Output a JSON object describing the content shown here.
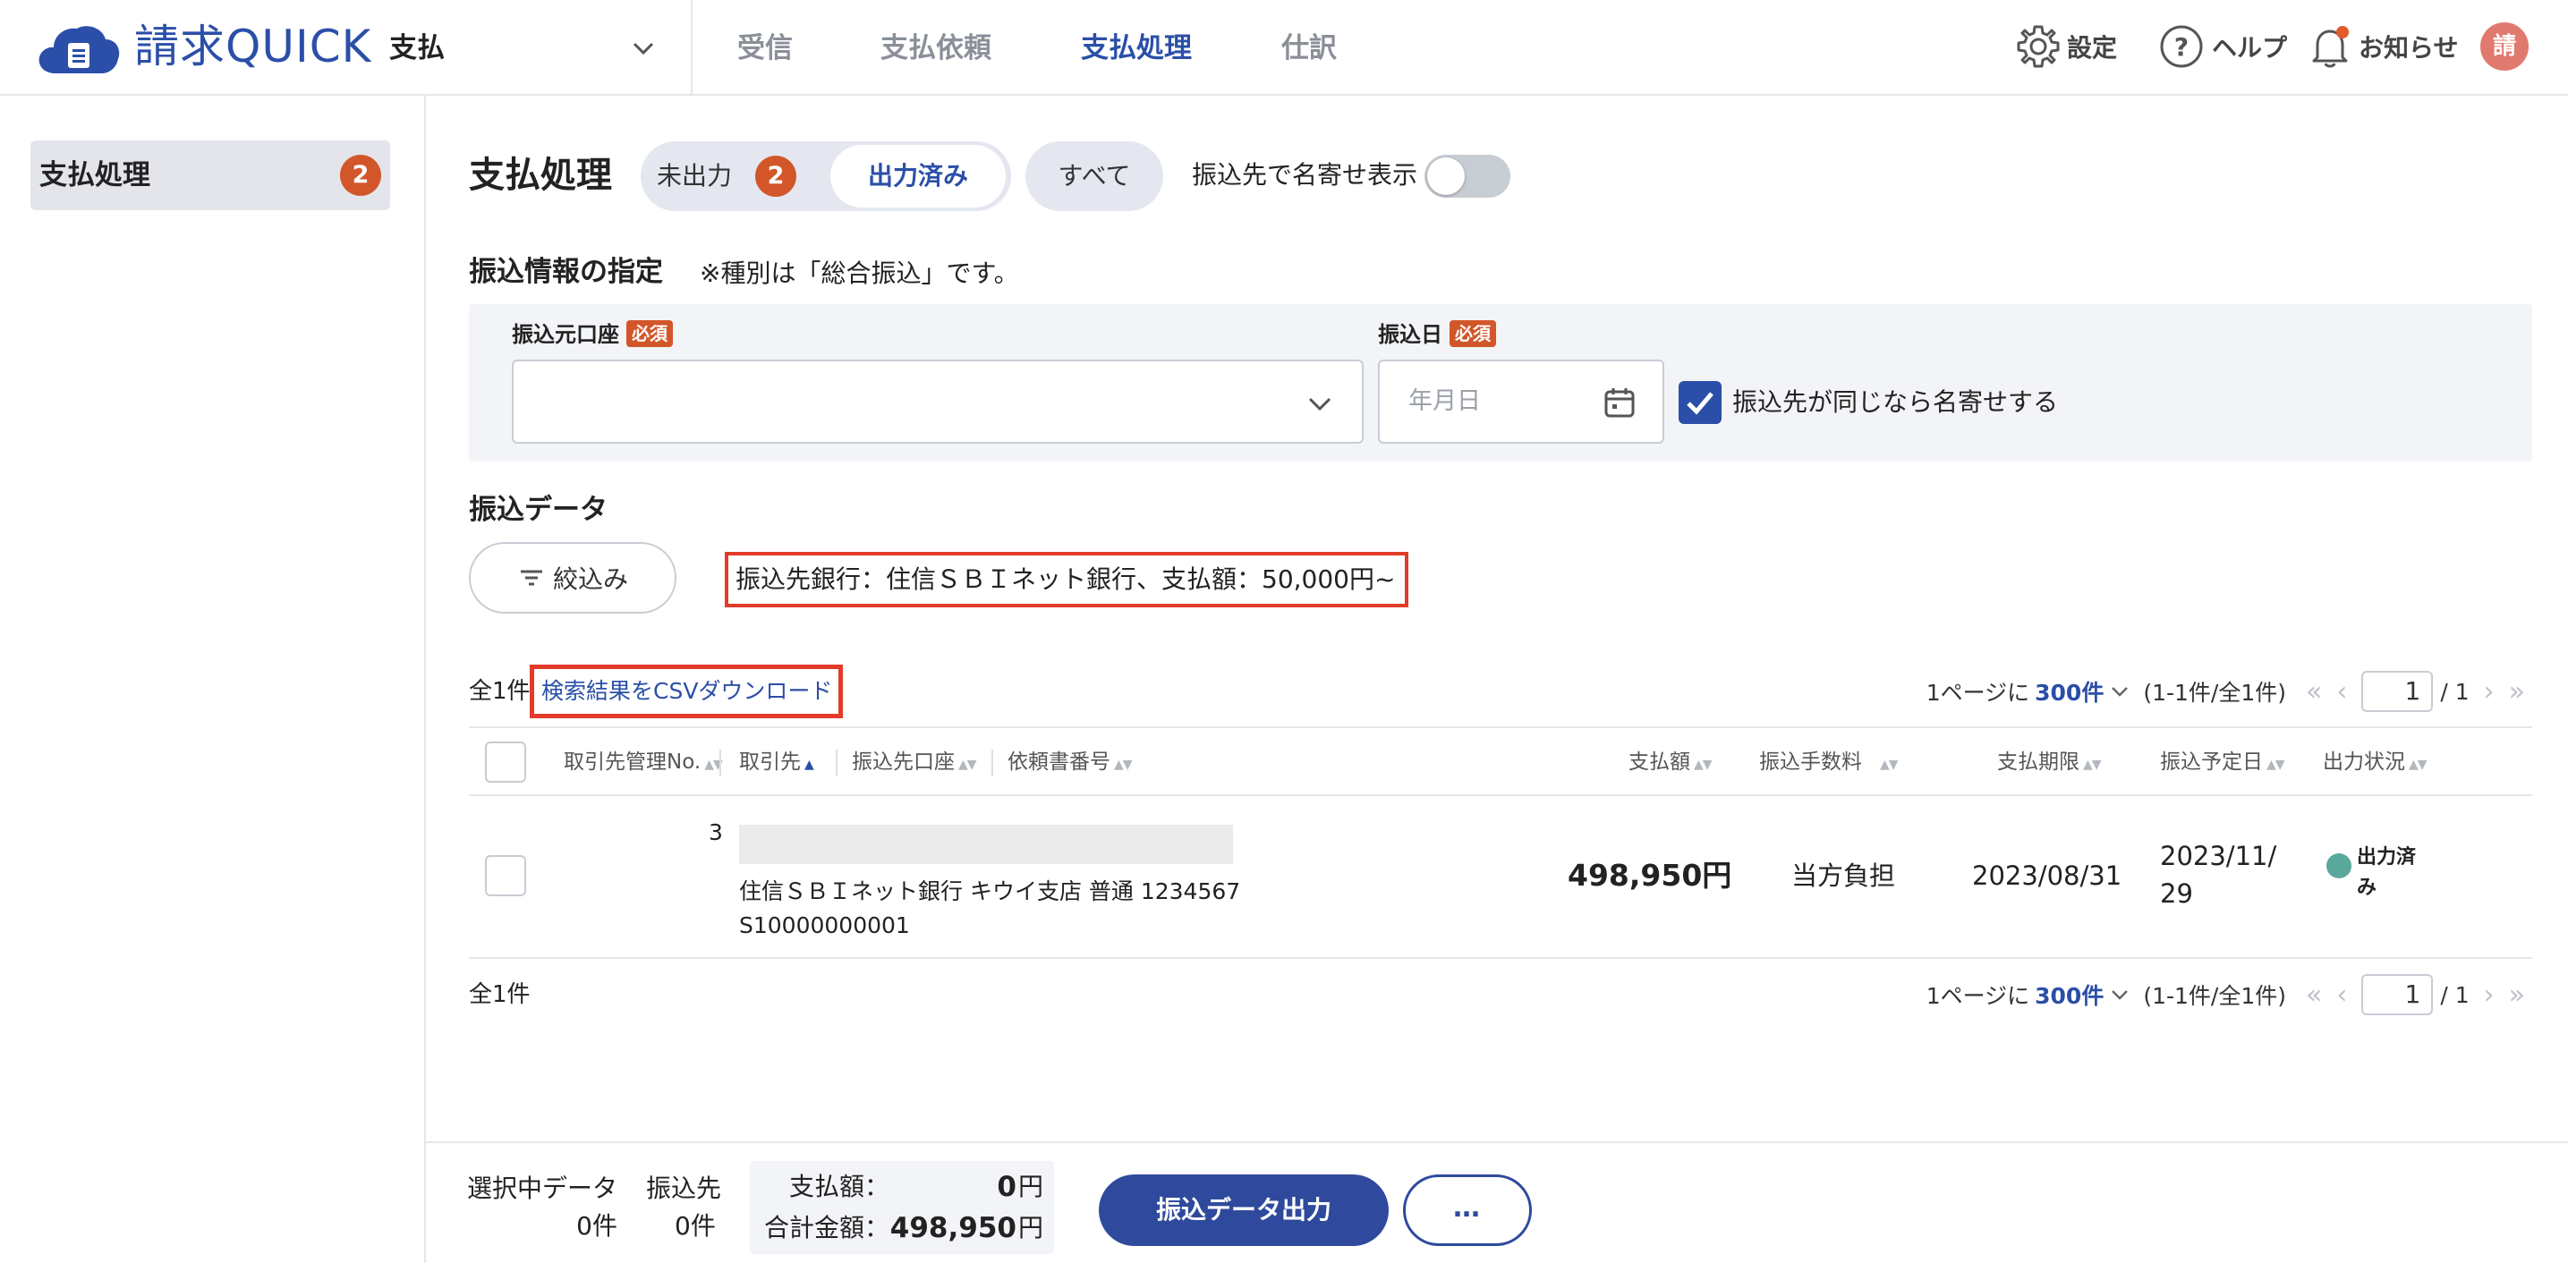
{
  "header": {
    "logo_text": "請求QUICK",
    "app_switch_label": "支払",
    "nav_tabs": [
      {
        "label": "受信"
      },
      {
        "label": "支払依頼"
      },
      {
        "label": "支払処理",
        "active": true
      },
      {
        "label": "仕訳"
      }
    ],
    "settings_label": "設定",
    "help_label": "ヘルプ",
    "notifications_label": "お知らせ",
    "avatar_text": "請",
    "accent_color": "#2b4fa8"
  },
  "sidebar": {
    "items": [
      {
        "label": "支払処理",
        "badge": "2"
      }
    ]
  },
  "main": {
    "title": "支払処理",
    "segments": {
      "unoutput_label": "未出力",
      "unoutput_badge": "2",
      "output_label": "出力済み",
      "all_label": "すべて"
    },
    "group_toggle_label": "振込先で名寄せ表示",
    "transfer_section": {
      "title": "振込情報の指定",
      "note": "※種別は「総合振込」です。",
      "source_account_label": "振込元口座",
      "source_account_value": "",
      "transfer_date_label": "振込日",
      "required_badge": "必須",
      "transfer_date_placeholder": "年月日",
      "group_check_label": "振込先が同じなら名寄せする",
      "group_check_checked": true
    },
    "data_section": {
      "title": "振込データ",
      "filter_button_label": "絞込み",
      "filter_summary": "振込先銀行：住信ＳＢＩネット銀行、支払額：50,000円~",
      "total_count": "全1件",
      "csv_download_label": "検索結果をCSVダウンロード",
      "pager": {
        "per_page_prefix": "1ページに",
        "per_page_value": "300件",
        "range": "(1-1件/全1件)",
        "current_page": "1",
        "total_pages": "/ 1"
      }
    },
    "table": {
      "columns": [
        "取引先管理No.",
        "取引先",
        "振込先口座",
        "依頼書番号",
        "支払額",
        "振込手数料",
        "支払期限",
        "振込予定日",
        "出力状況"
      ],
      "rows": [
        {
          "partner_no": "3",
          "partner_name": "",
          "account": "住信ＳＢＩネット銀行 キウイ支店 普通 1234567",
          "request_no": "S10000000001",
          "amount": "498,950円",
          "fee": "当方負担",
          "due_date": "2023/08/31",
          "scheduled_date_line1": "2023/11/",
          "scheduled_date_line2": "29",
          "status_line1": "出力済",
          "status_line2": "み",
          "status_color": "#5aa89b"
        }
      ]
    }
  },
  "footer": {
    "selected_label": "選択中データ",
    "selected_count": "0件",
    "payee_label": "振込先",
    "payee_count": "0件",
    "payment_amount_label": "支払額：",
    "payment_amount_value": "0",
    "total_amount_label": "合計金額：",
    "total_amount_value": "498,950",
    "yen": "円",
    "output_button_label": "振込データ出力",
    "more_button_label": "…"
  }
}
